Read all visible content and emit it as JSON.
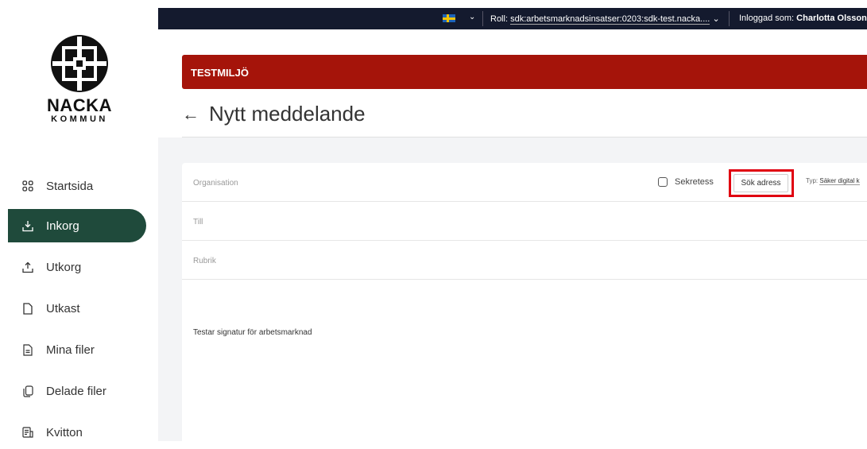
{
  "logo": {
    "name": "NACKA",
    "sub": "KOMMUN"
  },
  "sidebar": {
    "items": [
      {
        "label": "Startsida",
        "icon": "grid-icon"
      },
      {
        "label": "Inkorg",
        "icon": "inbox-icon",
        "active": true
      },
      {
        "label": "Utkorg",
        "icon": "outbox-icon"
      },
      {
        "label": "Utkast",
        "icon": "document-icon"
      },
      {
        "label": "Mina filer",
        "icon": "file-icon"
      },
      {
        "label": "Delade filer",
        "icon": "shared-files-icon"
      },
      {
        "label": "Kvitton",
        "icon": "receipt-icon"
      }
    ]
  },
  "topbar": {
    "role_label": "Roll:",
    "role_value": "sdk:arbetsmarknadsinsatser:0203:sdk-test.nacka....",
    "login_label": "Inloggad som:",
    "login_user": "Charlotta Olsson"
  },
  "banner": {
    "text": "TESTMILJÖ",
    "color": "#a5140a"
  },
  "page": {
    "title": "Nytt meddelande"
  },
  "form": {
    "organisation_label": "Organisation",
    "sekretess_label": "Sekretess",
    "sekretess_checked": false,
    "search_address_button": "Sök adress",
    "typ_label": "Typ:",
    "typ_value": "Säker digital k",
    "till_label": "Till",
    "rubrik_label": "Rubrik",
    "body": "Testar signatur för arbetsmarknad"
  },
  "colors": {
    "sidebar_active": "#1f4a3b",
    "topbar": "#141a2e",
    "highlight": "#e00010"
  }
}
